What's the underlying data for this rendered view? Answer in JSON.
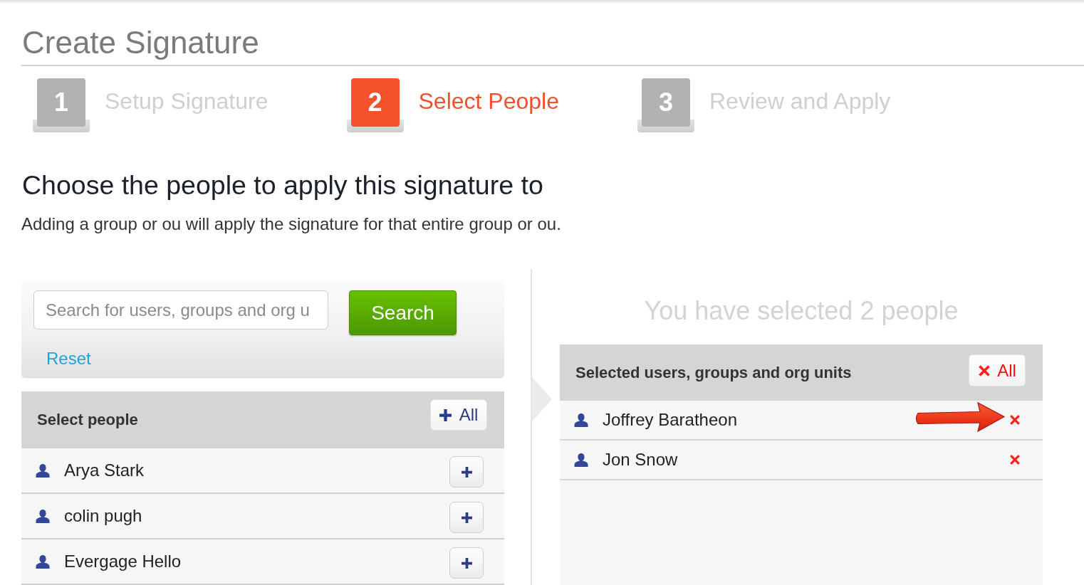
{
  "page": {
    "title": "Create Signature"
  },
  "steps": [
    {
      "number": "1",
      "label": "Setup Signature",
      "selected": false
    },
    {
      "number": "2",
      "label": "Select People",
      "selected": true
    },
    {
      "number": "3",
      "label": "Review and Apply",
      "selected": false
    }
  ],
  "intro": {
    "heading": "Choose the people to apply this signature to",
    "note": "Adding a group or ou will apply the signature for that entire group or ou."
  },
  "search": {
    "placeholder": "Search for users, groups and org u",
    "button": "Search",
    "reset": "Reset"
  },
  "picker": {
    "title": "Select people",
    "add_all": "All",
    "people": [
      {
        "name": "Arya Stark"
      },
      {
        "name": "colin pugh"
      },
      {
        "name": "Evergage Hello"
      }
    ]
  },
  "selection": {
    "summary": "You have selected 2 people",
    "title": "Selected users, groups and org units",
    "remove_all": "All",
    "people": [
      {
        "name": "Joffrey Baratheon",
        "arrow": true
      },
      {
        "name": "Jon Snow",
        "arrow": false
      }
    ]
  }
}
